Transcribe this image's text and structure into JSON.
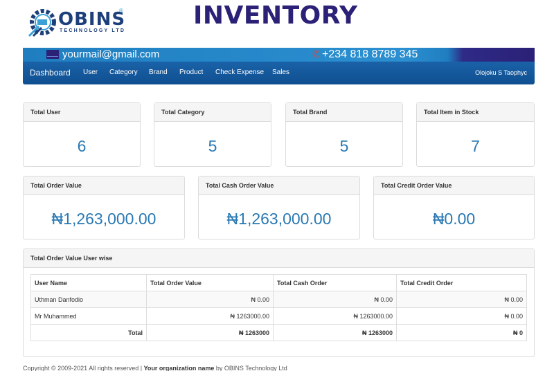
{
  "header": {
    "logo_text": "OBINS",
    "logo_sub": "TECHNOLOGY LTD",
    "logo_reg": "®",
    "title": "INVENTORY"
  },
  "contact": {
    "email": "yourmail@gmail.com",
    "phone": "+234 818 8789 345",
    "mail_icon": "envelope-icon",
    "phone_icon": "phone-icon",
    "phone_glyph": "✆"
  },
  "nav": {
    "brand": "Dashboard",
    "items": [
      "User",
      "Category",
      "Brand",
      "Product",
      "Check Expense",
      "Sales"
    ],
    "user": "Olojoku S Taophyc"
  },
  "stats_row1": [
    {
      "label": "Total User",
      "value": "6"
    },
    {
      "label": "Total Category",
      "value": "5"
    },
    {
      "label": "Total Brand",
      "value": "5"
    },
    {
      "label": "Total Item in Stock",
      "value": "7"
    }
  ],
  "stats_row2": [
    {
      "label": "Total Order Value",
      "value": "₦1,263,000.00"
    },
    {
      "label": "Total Cash Order Value",
      "value": "₦1,263,000.00"
    },
    {
      "label": "Total Credit Order Value",
      "value": "₦0.00"
    }
  ],
  "userwise": {
    "title": "Total Order Value User wise",
    "columns": [
      "User Name",
      "Total Order Value",
      "Total Cash Order",
      "Total Credit Order"
    ],
    "rows": [
      [
        "Uthman Danfodio",
        "₦ 0.00",
        "₦ 0.00",
        "₦ 0.00"
      ],
      [
        "Mr Muhammed",
        "₦ 1263000.00",
        "₦ 1263000.00",
        "₦ 0.00"
      ]
    ],
    "total": [
      "Total",
      "₦ 1263000",
      "₦ 1263000",
      "₦ 0"
    ]
  },
  "footer": {
    "prefix": "Copyright © 2009-2021 All rights reserved | ",
    "org": "Your organization name",
    "suffix": " by OBINS Technology Ltd"
  },
  "colors": {
    "nav": "#1a62a8",
    "title": "#2b2177",
    "value": "#2a79b3",
    "phone_icon": "#e0443a"
  }
}
